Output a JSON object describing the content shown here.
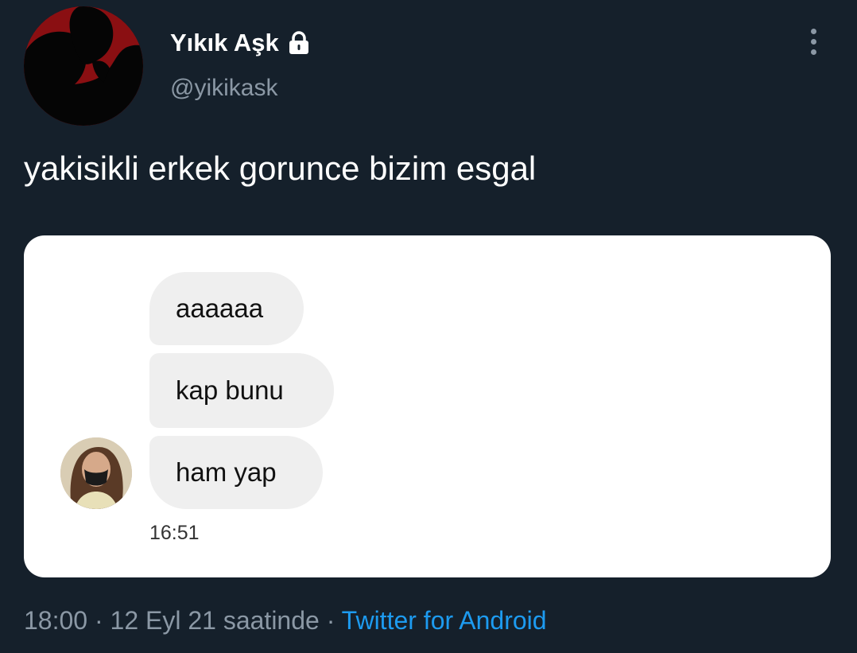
{
  "tweet": {
    "author": {
      "display_name": "Yıkık Aşk",
      "handle": "@yikikask",
      "protected_icon": "lock-icon",
      "avatar": "silhouette-couple-avatar"
    },
    "menu_icon": "more-vertical-icon",
    "text": "yakisikli erkek gorunce bizim esgal",
    "media": {
      "chat": {
        "messages": [
          "aaaaaa",
          "kap bunu",
          "ham yap"
        ],
        "timestamp": "16:51",
        "sender_avatar": "masked-woman-avatar"
      }
    },
    "meta": {
      "time": "18:00",
      "separator": " · ",
      "date_text": "12 Eyl 21 saatinde",
      "source": "Twitter for Android"
    }
  },
  "colors": {
    "background": "#15202b",
    "secondary_text": "#8b98a5",
    "link": "#1d9bf0",
    "bubble": "#efefef"
  }
}
